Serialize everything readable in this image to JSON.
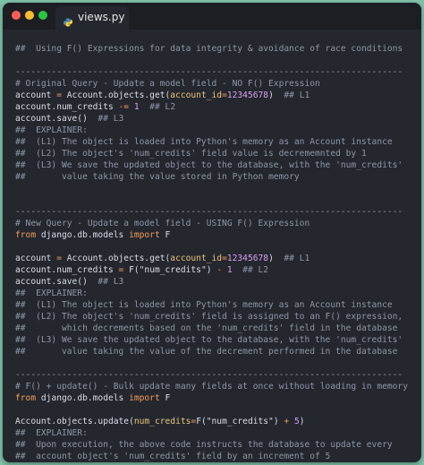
{
  "window": {
    "tab_title": "views.py"
  },
  "colors": {
    "background": "#7ec1a8",
    "editor": "#24272e",
    "comment": "#8e97a6",
    "keyword": "#f39c5b",
    "number": "#d7a0f0",
    "param": "#e6c47a",
    "text": "#d8dee9"
  },
  "code": [
    [
      {
        "t": "##  Using F() Expressions for data integrity & avoidance of race conditions",
        "s": "c"
      }
    ],
    [],
    [
      {
        "t": "---------------------------------------------------------------------------",
        "s": "c"
      }
    ],
    [
      {
        "t": "# Original Query - Update a model field - NO F() Expression",
        "s": "c"
      }
    ],
    [
      {
        "t": "account",
        "s": "fn"
      },
      {
        "t": " = ",
        "s": "op"
      },
      {
        "t": "Account.objects.get(",
        "s": "fn"
      },
      {
        "t": "account_id",
        "s": "param"
      },
      {
        "t": "=",
        "s": "op"
      },
      {
        "t": "12345678",
        "s": "num"
      },
      {
        "t": ")  ",
        "s": "fn"
      },
      {
        "t": "## L1",
        "s": "c"
      }
    ],
    [
      {
        "t": "account.num_credits ",
        "s": "fn"
      },
      {
        "t": "-=",
        "s": "op"
      },
      {
        "t": " ",
        "s": "fn"
      },
      {
        "t": "1",
        "s": "num"
      },
      {
        "t": "  ",
        "s": "fn"
      },
      {
        "t": "## L2",
        "s": "c"
      }
    ],
    [
      {
        "t": "account.save()  ",
        "s": "fn"
      },
      {
        "t": "## L3",
        "s": "c"
      }
    ],
    [
      {
        "t": "##  EXPLAINER:",
        "s": "c"
      }
    ],
    [
      {
        "t": "##  (L1) The object is loaded into Python's memory as an Account instance",
        "s": "c"
      }
    ],
    [
      {
        "t": "##  (L2) The object's 'num_credits' field value is decrememnted by 1",
        "s": "c"
      }
    ],
    [
      {
        "t": "##  (L3) We save the updated object to the database, with the 'num_credits'",
        "s": "c"
      }
    ],
    [
      {
        "t": "##       value taking the value stored in Python memory",
        "s": "c"
      }
    ],
    [],
    [],
    [
      {
        "t": "---------------------------------------------------------------------------",
        "s": "c"
      }
    ],
    [
      {
        "t": "# New Query - Update a model field - USING F() Expression",
        "s": "c"
      }
    ],
    [
      {
        "t": "from",
        "s": "kw"
      },
      {
        "t": " django.db.models ",
        "s": "fn"
      },
      {
        "t": "import",
        "s": "kw"
      },
      {
        "t": " F",
        "s": "fn"
      }
    ],
    [],
    [
      {
        "t": "account",
        "s": "fn"
      },
      {
        "t": " = ",
        "s": "op"
      },
      {
        "t": "Account.objects.get(",
        "s": "fn"
      },
      {
        "t": "account_id",
        "s": "param"
      },
      {
        "t": "=",
        "s": "op"
      },
      {
        "t": "12345678",
        "s": "num"
      },
      {
        "t": ")  ",
        "s": "fn"
      },
      {
        "t": "## L1",
        "s": "c"
      }
    ],
    [
      {
        "t": "account.num_credits ",
        "s": "fn"
      },
      {
        "t": "=",
        "s": "op"
      },
      {
        "t": " F(",
        "s": "fn"
      },
      {
        "t": "\"num_credits\"",
        "s": "str"
      },
      {
        "t": ") ",
        "s": "fn"
      },
      {
        "t": "-",
        "s": "op"
      },
      {
        "t": " ",
        "s": "fn"
      },
      {
        "t": "1",
        "s": "num"
      },
      {
        "t": "  ",
        "s": "fn"
      },
      {
        "t": "## L2",
        "s": "c"
      }
    ],
    [
      {
        "t": "account.save()  ",
        "s": "fn"
      },
      {
        "t": "## L3",
        "s": "c"
      }
    ],
    [
      {
        "t": "##  EXPLAINER:",
        "s": "c"
      }
    ],
    [
      {
        "t": "##  (L1) The object is loaded into Python's memory as an Account instance",
        "s": "c"
      }
    ],
    [
      {
        "t": "##  (L2) The object's 'num_credits' field is assigned to an F() expression,",
        "s": "c"
      }
    ],
    [
      {
        "t": "##       which decrements based on the 'num_credits' field in the database",
        "s": "c"
      }
    ],
    [
      {
        "t": "##  (L3) We save the updated object to the database, with the 'num_credits'",
        "s": "c"
      }
    ],
    [
      {
        "t": "##       value taking the value of the decrement performed in the database",
        "s": "c"
      }
    ],
    [],
    [
      {
        "t": "---------------------------------------------------------------------------",
        "s": "c"
      }
    ],
    [
      {
        "t": "# F() + update() - Bulk update many fields at once without loading in memory",
        "s": "c"
      }
    ],
    [
      {
        "t": "from",
        "s": "kw"
      },
      {
        "t": " django.db.models ",
        "s": "fn"
      },
      {
        "t": "import",
        "s": "kw"
      },
      {
        "t": " F",
        "s": "fn"
      }
    ],
    [],
    [
      {
        "t": "Account.objects.update(",
        "s": "fn"
      },
      {
        "t": "num_credits",
        "s": "param"
      },
      {
        "t": "=",
        "s": "op"
      },
      {
        "t": "F(",
        "s": "fn"
      },
      {
        "t": "\"num_credits\"",
        "s": "str"
      },
      {
        "t": ") ",
        "s": "fn"
      },
      {
        "t": "+",
        "s": "op"
      },
      {
        "t": " ",
        "s": "fn"
      },
      {
        "t": "5",
        "s": "num"
      },
      {
        "t": ")",
        "s": "fn"
      }
    ],
    [
      {
        "t": "##  EXPLAINER:",
        "s": "c"
      }
    ],
    [
      {
        "t": "##  Upon execution, the above code instructs the database to update every",
        "s": "c"
      }
    ],
    [
      {
        "t": "##  account object's 'num_credits' field by an increment of 5",
        "s": "c"
      }
    ]
  ]
}
